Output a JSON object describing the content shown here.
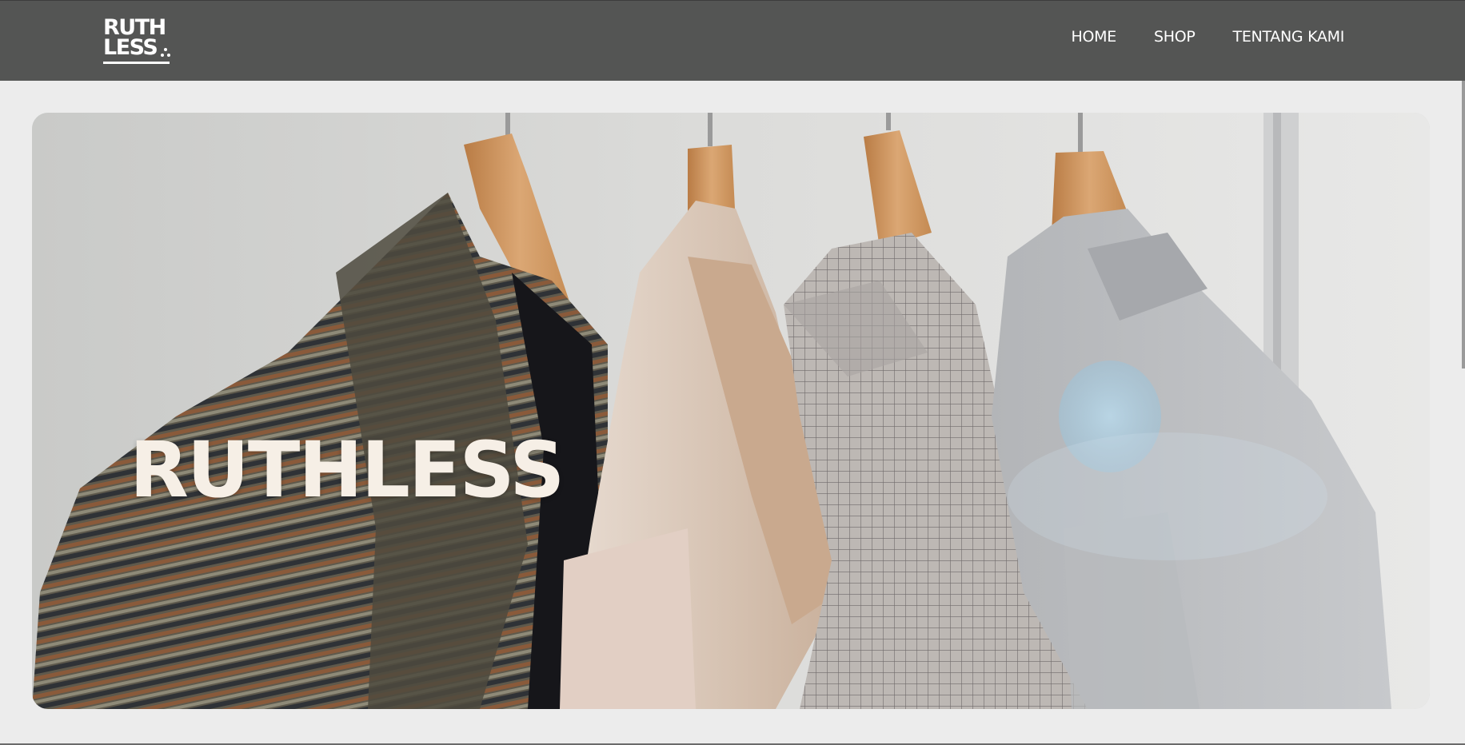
{
  "brand": {
    "logo_line1": "RUTH",
    "logo_line2": "LESS",
    "logo_alt": "RUTHLESS"
  },
  "nav": {
    "items": [
      {
        "label": "HOME"
      },
      {
        "label": "SHOP"
      },
      {
        "label": "TENTANG KAMI"
      }
    ]
  },
  "hero": {
    "title": "RUTHLESS",
    "image_subject": "clothes-on-hangers-image"
  },
  "colors": {
    "navbar_bg": "#545554",
    "page_bg": "#ececec",
    "hero_title": "#f6efe6",
    "nav_text": "#ffffff"
  }
}
